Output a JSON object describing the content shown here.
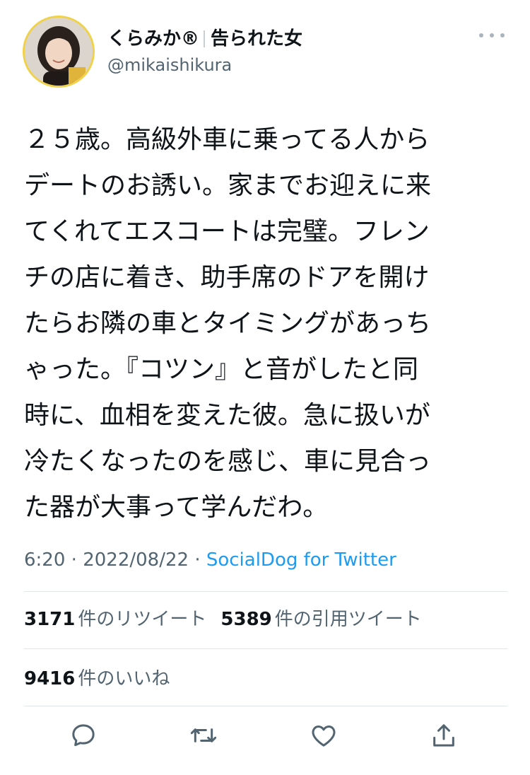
{
  "user": {
    "display_name": "くらみか®",
    "display_name_suffix": "告られた女",
    "handle": "@mikaishikura"
  },
  "tweet": {
    "text": "２５歳。高級外車に乗ってる人から\nデートのお誘い。家までお迎えに来\nてくれてエスコートは完璧。フレン\nチの店に着き、助手席のドアを開け\nたらお隣の車とタイミングがあっち\nゃった。『コツン』と音がしたと同\n時に、血相を変えた彼。急に扱いが\n冷たくなったのを感じ、車に見合っ\nた器が大事って学んだわ。",
    "time": "6:20",
    "date": "2022/08/22",
    "separator": "·",
    "source": "SocialDog for Twitter"
  },
  "stats": {
    "retweets_count": "3171",
    "retweets_label": "件のリツイート",
    "quotes_count": "5389",
    "quotes_label": "件の引用ツイート",
    "likes_count": "9416",
    "likes_label": "件のいいね"
  },
  "icons": {
    "more": "more-dots-icon",
    "reply": "reply-bubble-icon",
    "retweet": "retweet-arrows-icon",
    "like": "heart-icon",
    "share": "share-upload-icon"
  },
  "colors": {
    "link": "#1d9bf0",
    "secondary_text": "#536471",
    "icon": "#536471",
    "avatar_ring": "#f0d24a"
  }
}
